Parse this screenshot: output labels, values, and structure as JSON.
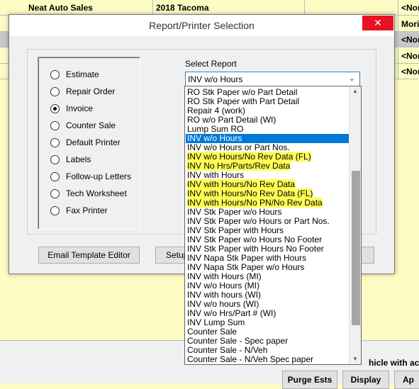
{
  "background": {
    "rows": [
      {
        "name": "Neat Auto Sales",
        "vehicle": "2018 Tacoma",
        "right": "<Non",
        "selected": false
      },
      {
        "name": "",
        "vehicle": "",
        "right": "Mori",
        "selected": false
      },
      {
        "name": "",
        "vehicle": "",
        "right": "<Non",
        "selected": true
      },
      {
        "name": "",
        "vehicle": "",
        "right": "<Non",
        "selected": false
      },
      {
        "name": "",
        "vehicle": "",
        "right": "<Non",
        "selected": false
      }
    ],
    "bottom_text": "hicle with active",
    "purge_label": "Purge Ests",
    "display_label": "Display",
    "ap_label": "Ap"
  },
  "dialog": {
    "title": "Report/Printer Selection",
    "close_glyph": "✕",
    "radio_options": [
      {
        "label": "Estimate",
        "checked": false
      },
      {
        "label": "Repair Order",
        "checked": false
      },
      {
        "label": "Invoice",
        "checked": true
      },
      {
        "label": "Counter Sale",
        "checked": false
      },
      {
        "label": "Default Printer",
        "checked": false
      },
      {
        "label": "Labels",
        "checked": false
      },
      {
        "label": "Follow-up Letters",
        "checked": false
      },
      {
        "label": "Tech Worksheet",
        "checked": false
      },
      {
        "label": "Fax Printer",
        "checked": false
      }
    ],
    "select_label": "Select Report",
    "select_value": "INV w/o Hours",
    "email_button": "Email Template Editor",
    "setup_button": "Setup"
  },
  "dropdown": {
    "items": [
      {
        "label": "RO Stk Paper w/o Part Detail",
        "selected": false,
        "highlighted": false
      },
      {
        "label": "RO Stk Paper with Part Detail",
        "selected": false,
        "highlighted": false
      },
      {
        "label": "Repair 4 (work)",
        "selected": false,
        "highlighted": false
      },
      {
        "label": "RO w/o Part Detail (WI)",
        "selected": false,
        "highlighted": false
      },
      {
        "label": "Lump Sum RO",
        "selected": false,
        "highlighted": false
      },
      {
        "label": "INV w/o Hours",
        "selected": true,
        "highlighted": false
      },
      {
        "label": "INV w/o Hours or Part Nos.",
        "selected": false,
        "highlighted": false
      },
      {
        "label": "INV w/o Hours/No Rev Data (FL)",
        "selected": false,
        "highlighted": true
      },
      {
        "label": "INV No Hrs/Parts/Rev Data",
        "selected": false,
        "highlighted": true
      },
      {
        "label": "INV with Hours",
        "selected": false,
        "highlighted": false
      },
      {
        "label": "INV with Hours/No Rev Data",
        "selected": false,
        "highlighted": true
      },
      {
        "label": "INV with Hours/No Rev Data (FL)",
        "selected": false,
        "highlighted": true
      },
      {
        "label": "INV with Hours/No PN/No Rev Data",
        "selected": false,
        "highlighted": true
      },
      {
        "label": "INV Stk Paper w/o Hours",
        "selected": false,
        "highlighted": false
      },
      {
        "label": "INV Stk Paper w/o Hours or Part Nos.",
        "selected": false,
        "highlighted": false
      },
      {
        "label": "INV Stk Paper with Hours",
        "selected": false,
        "highlighted": false
      },
      {
        "label": "INV Stk Paper w/o Hours No Footer",
        "selected": false,
        "highlighted": false
      },
      {
        "label": "INV Stk Paper with Hours No Footer",
        "selected": false,
        "highlighted": false
      },
      {
        "label": "INV Napa Stk Paper with Hours",
        "selected": false,
        "highlighted": false
      },
      {
        "label": "INV Napa Stk Paper w/o Hours",
        "selected": false,
        "highlighted": false
      },
      {
        "label": "INV with Hours (MI)",
        "selected": false,
        "highlighted": false
      },
      {
        "label": "INV w/o Hours (MI)",
        "selected": false,
        "highlighted": false
      },
      {
        "label": "INV with hours (WI)",
        "selected": false,
        "highlighted": false
      },
      {
        "label": "INV w/o hours (WI)",
        "selected": false,
        "highlighted": false
      },
      {
        "label": "INV w/o Hrs/Part # (WI)",
        "selected": false,
        "highlighted": false
      },
      {
        "label": "INV Lump Sum",
        "selected": false,
        "highlighted": false
      },
      {
        "label": "Counter Sale",
        "selected": false,
        "highlighted": false
      },
      {
        "label": "Counter Sale - Spec paper",
        "selected": false,
        "highlighted": false
      },
      {
        "label": "Counter Sale - N/Veh",
        "selected": false,
        "highlighted": false
      },
      {
        "label": "Counter Sale - N/Veh Spec paper",
        "selected": false,
        "highlighted": false
      }
    ],
    "scroll_up_icon": "▲",
    "scroll_down_icon": "▼",
    "scroll_position": 0.72,
    "selection_color": "#0078d7",
    "highlight_color": "#fffd55"
  }
}
